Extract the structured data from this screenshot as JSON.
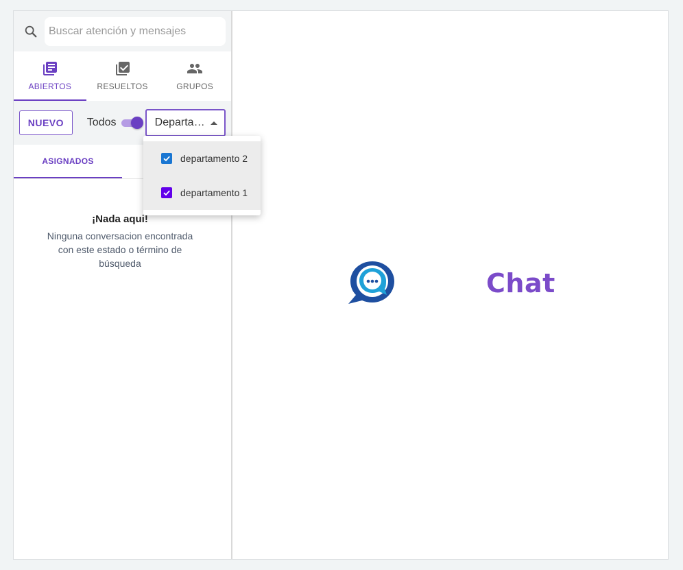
{
  "search": {
    "placeholder": "Buscar atención y mensajes"
  },
  "tabs": [
    {
      "label": "ABIERTOS",
      "icon": "inbox-list-icon",
      "active": true
    },
    {
      "label": "RESUELTOS",
      "icon": "checklist-icon",
      "active": false
    },
    {
      "label": "GRUPOS",
      "icon": "group-icon",
      "active": false
    }
  ],
  "toolbar": {
    "new_label": "NUEVO",
    "todos_label": "Todos",
    "select_value": "Departa…"
  },
  "sub_tabs": [
    {
      "label": "ASIGNADOS"
    }
  ],
  "dropdown": {
    "items": [
      {
        "label": "departamento 2",
        "checked": true,
        "color": "#1976d2"
      },
      {
        "label": "departamento 1",
        "checked": true,
        "color": "#6200ea"
      }
    ]
  },
  "empty": {
    "title": "¡Nada aqui!",
    "text": "Ninguna conversacion encontrada con este estado o término de búsqueda"
  },
  "logo": {
    "text": "Chat"
  },
  "colors": {
    "accent": "#6a3fc2",
    "logo_blue": "#1e4fa0",
    "logo_cyan": "#1fa1d8"
  }
}
